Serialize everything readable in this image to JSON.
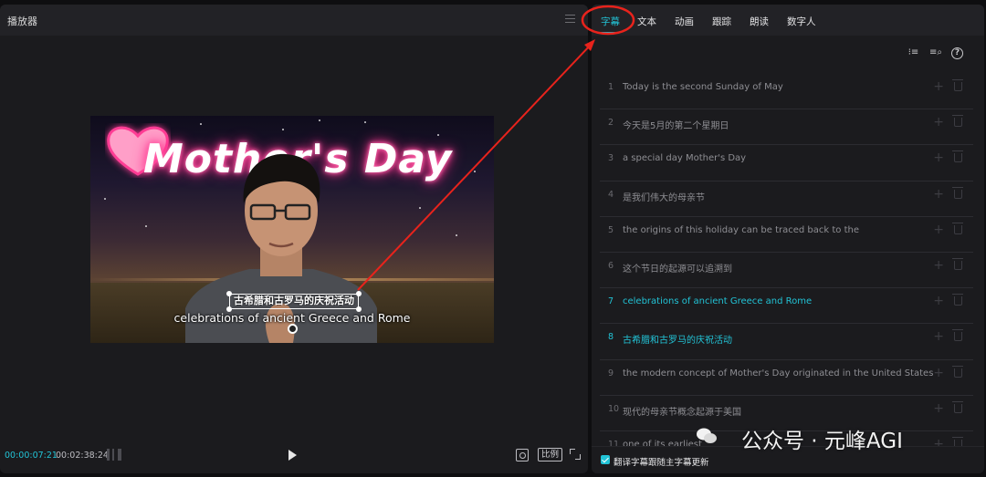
{
  "player": {
    "title": "播放器",
    "video": {
      "title_art": "Mother's Day",
      "subtitle_cn": "古希腊和古罗马的庆祝活动",
      "subtitle_en": "celebrations of ancient Greece and Rome"
    },
    "current_time": "00:00:07:21",
    "total_time": "00:02:38:24",
    "ratio_label": "比例"
  },
  "panel": {
    "tabs": [
      {
        "label": "字幕",
        "active": true
      },
      {
        "label": "文本",
        "active": false
      },
      {
        "label": "动画",
        "active": false
      },
      {
        "label": "跟踪",
        "active": false
      },
      {
        "label": "朗读",
        "active": false
      },
      {
        "label": "数字人",
        "active": false
      }
    ],
    "toolbar_icons": [
      "subtitle-style-icon",
      "search-replace-icon",
      "help-icon"
    ],
    "subtitles": [
      {
        "num": "1",
        "text": "Today is the second Sunday of May",
        "highlighted": false
      },
      {
        "num": "2",
        "text": "今天是5月的第二个星期日",
        "highlighted": false
      },
      {
        "num": "3",
        "text": " a special day Mother's Day",
        "highlighted": false
      },
      {
        "num": "4",
        "text": "是我们伟大的母亲节",
        "highlighted": false
      },
      {
        "num": "5",
        "text": "the origins of this holiday can be traced back to the",
        "highlighted": false
      },
      {
        "num": "6",
        "text": "这个节日的起源可以追溯到",
        "highlighted": false
      },
      {
        "num": "7",
        "text": "celebrations of ancient Greece and Rome",
        "highlighted": true
      },
      {
        "num": "8",
        "text": "古希腊和古罗马的庆祝活动",
        "highlighted": true
      },
      {
        "num": "9",
        "text": "the modern concept of Mother's Day originated in the United States",
        "highlighted": false
      },
      {
        "num": "10",
        "text": "现代的母亲节概念起源于美国",
        "highlighted": false
      },
      {
        "num": "11",
        "text": "one of its earliest",
        "highlighted": false
      }
    ],
    "footer_checkbox": {
      "label": "翻译字幕跟随主字幕更新",
      "checked": true
    }
  },
  "watermark": {
    "text": "公众号 · 元峰AGI"
  },
  "colors": {
    "accent": "#22c3d6",
    "annotation": "#e8231c"
  }
}
